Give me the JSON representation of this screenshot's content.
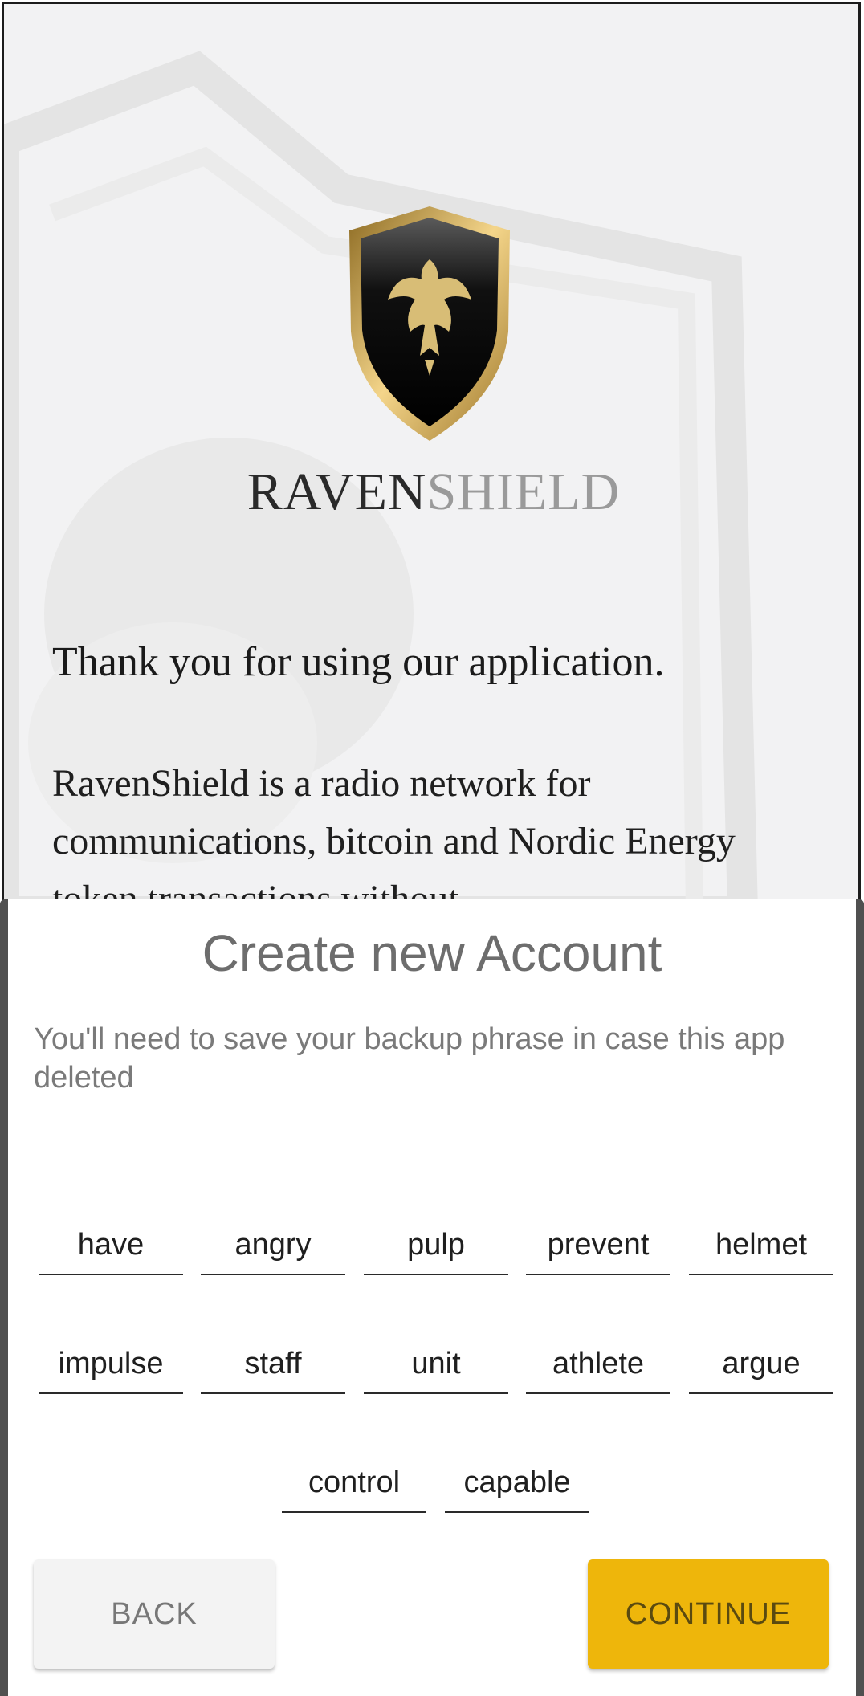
{
  "splash": {
    "brand_dark": "RAVEN",
    "brand_light": "SHIELD",
    "thanks": "Thank you for using our application.",
    "description": "RavenShield is a radio network for communications, bitcoin and Nordic Energy token transactions without"
  },
  "dialog": {
    "title": "Create new Account",
    "subtitle": "You'll need to save your backup phrase in case this app deleted",
    "words": [
      "have",
      "angry",
      "pulp",
      "prevent",
      "helmet",
      "impulse",
      "staff",
      "unit",
      "athlete",
      "argue",
      "control",
      "capable"
    ],
    "back_label": "BACK",
    "continue_label": "CONTINUE"
  },
  "colors": {
    "accent": "#eeb60b",
    "logo_gold": "#c9a45a"
  },
  "icons": {
    "logo": "raven-shield-logo"
  }
}
